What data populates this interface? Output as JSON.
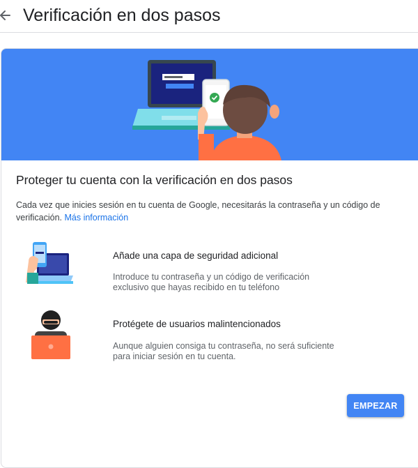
{
  "header": {
    "title": "Verificación en dos pasos",
    "back_icon": "arrow-back-icon"
  },
  "main": {
    "headline": "Proteger tu cuenta con la verificación en dos pasos",
    "description": "Cada vez que inicies sesión en tu cuenta de Google, necesitarás la contraseña y un código de verificación.",
    "more_info_link": "Más información"
  },
  "features": [
    {
      "icon": "phone-laptop-icon",
      "title": "Añade una capa de seguridad adicional",
      "text": "Introduce tu contraseña y un código de verificación exclusivo que hayas recibido en tu teléfono"
    },
    {
      "icon": "hacker-icon",
      "title": "Protégete de usuarios malintencionados",
      "text": "Aunque alguien consiga tu contraseña, no será suficiente para iniciar sesión en tu cuenta."
    }
  ],
  "actions": {
    "start_label": "EMPEZAR"
  },
  "colors": {
    "hero_background": "#4285f4",
    "link": "#1a73e8",
    "button": "#4285f4"
  }
}
